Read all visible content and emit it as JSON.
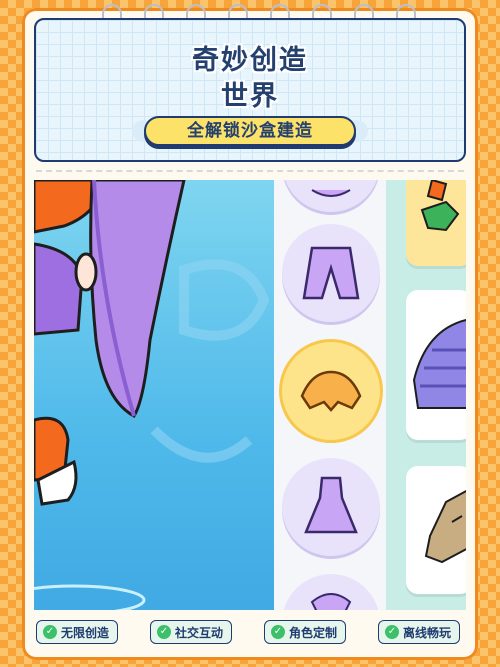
{
  "header": {
    "title_line1": "奇妙创造",
    "title_line2": "世界",
    "subtitle": "全解锁沙盒建造"
  },
  "features": [
    {
      "label": "无限创造",
      "icon": "check-icon"
    },
    {
      "label": "社交互动",
      "icon": "check-icon"
    },
    {
      "label": "角色定制",
      "icon": "check-icon"
    },
    {
      "label": "离线畅玩",
      "icon": "check-icon"
    }
  ],
  "wardrobe": {
    "items": [
      {
        "icon": "partial-outfit-icon"
      },
      {
        "icon": "pants-icon"
      },
      {
        "icon": "cape-top-icon",
        "selected": true
      },
      {
        "icon": "dress-icon"
      },
      {
        "icon": "partial-outfit-icon"
      }
    ]
  },
  "colors": {
    "accent_orange": "#f08a1c",
    "navy": "#1f3b70",
    "pill_yellow": "#fde26a",
    "check_green": "#3cc06a"
  }
}
